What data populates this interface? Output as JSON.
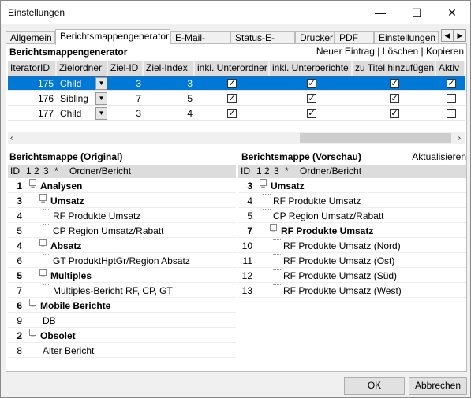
{
  "window": {
    "title": "Einstellungen",
    "minimize": "—",
    "maximize": "☐",
    "close": "✕"
  },
  "tabs": [
    "Allgemein",
    "Berichtsmappengenerator",
    "E-Mail-Server",
    "Status-E-Mail",
    "Drucker",
    "PDF",
    "Einstellungen"
  ],
  "tab_arrows": {
    "left": "◀",
    "right": "▶"
  },
  "section": {
    "title": "Berichtsmappengenerator",
    "new": "Neuer Eintrag",
    "delete": "Löschen",
    "copy": "Kopieren",
    "sep": "|"
  },
  "grid": {
    "columns": [
      "IteratorID",
      "Zielordner",
      "Ziel-ID",
      "Ziel-Index",
      "inkl. Unterordner",
      "inkl. Unterberichte",
      "zu Titel hinzufügen",
      "Aktiv"
    ],
    "rows": [
      {
        "id": "175",
        "folder": "Child",
        "ziel_id": "3",
        "ziel_index": "3",
        "unterordner": true,
        "unterberichte": true,
        "titel": true,
        "aktiv": true,
        "selected": true
      },
      {
        "id": "176",
        "folder": "Sibling",
        "ziel_id": "7",
        "ziel_index": "5",
        "unterordner": true,
        "unterberichte": true,
        "titel": true,
        "aktiv": false
      },
      {
        "id": "177",
        "folder": "Child",
        "ziel_id": "3",
        "ziel_index": "4",
        "unterordner": true,
        "unterberichte": true,
        "titel": true,
        "aktiv": false
      }
    ]
  },
  "tree_header": {
    "id": "ID",
    "c1": "1",
    "c2": "2",
    "c3": "3",
    "star": "*",
    "name": "Ordner/Bericht"
  },
  "original": {
    "title": "Berichtsmappe (Original)",
    "rows": [
      {
        "id": "1",
        "label": "Analysen",
        "level": 0,
        "folder": true
      },
      {
        "id": "3",
        "label": "Umsatz",
        "level": 1,
        "folder": true
      },
      {
        "id": "4",
        "label": "RF Produkte Umsatz",
        "level": 2
      },
      {
        "id": "5",
        "label": "CP Region Umsatz/Rabatt",
        "level": 2
      },
      {
        "id": "4",
        "label": "Absatz",
        "level": 1,
        "folder": true
      },
      {
        "id": "6",
        "label": "GT ProduktHptGr/Region Absatz",
        "level": 2
      },
      {
        "id": "5",
        "label": "Multiples",
        "level": 1,
        "folder": true
      },
      {
        "id": "7",
        "label": "Multiples-Bericht RF, CP, GT",
        "level": 2
      },
      {
        "id": "6",
        "label": "Mobile Berichte",
        "level": 0,
        "folder": true
      },
      {
        "id": "9",
        "label": "DB",
        "level": 1
      },
      {
        "id": "2",
        "label": "Obsolet",
        "level": 0,
        "folder": true
      },
      {
        "id": "8",
        "label": "Alter Bericht",
        "level": 1
      }
    ]
  },
  "preview": {
    "title": "Berichtsmappe (Vorschau)",
    "refresh": "Aktualisieren",
    "rows": [
      {
        "id": "3",
        "label": "Umsatz",
        "level": 0,
        "folder": true
      },
      {
        "id": "4",
        "label": "RF Produkte Umsatz",
        "level": 1
      },
      {
        "id": "5",
        "label": "CP Region Umsatz/Rabatt",
        "level": 1
      },
      {
        "id": "7",
        "label": "RF Produkte Umsatz",
        "level": 1,
        "folder": true
      },
      {
        "id": "10",
        "label": "RF Produkte Umsatz (Nord)",
        "level": 2
      },
      {
        "id": "11",
        "label": "RF Produkte Umsatz (Ost)",
        "level": 2
      },
      {
        "id": "12",
        "label": "RF Produkte Umsatz (Süd)",
        "level": 2
      },
      {
        "id": "13",
        "label": "RF Produkte Umsatz (West)",
        "level": 2
      }
    ]
  },
  "buttons": {
    "ok": "OK",
    "cancel": "Abbrechen"
  },
  "colors": {
    "selection": "#0078d7"
  }
}
